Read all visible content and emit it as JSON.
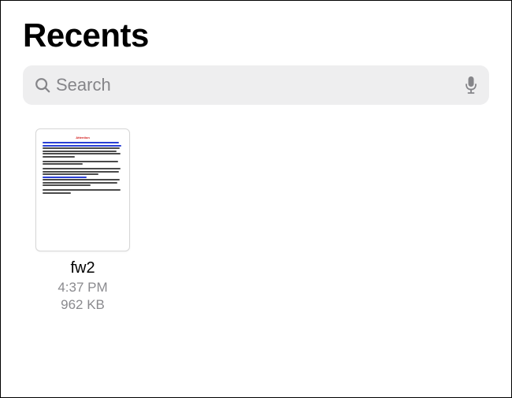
{
  "header": {
    "title": "Recents"
  },
  "search": {
    "placeholder": "Search",
    "value": ""
  },
  "files": [
    {
      "name": "fw2",
      "time": "4:37 PM",
      "size": "962 KB",
      "preview_heading": "Attention",
      "preview_heading_color": "#d21b1b"
    }
  ],
  "icons": {
    "search": "search-icon",
    "mic": "mic-icon"
  }
}
